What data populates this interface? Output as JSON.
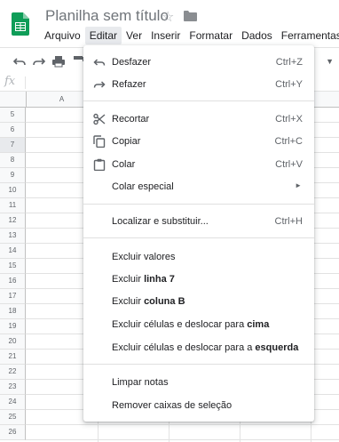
{
  "header": {
    "title": "Planilha sem título",
    "star_icon": "star-outline-icon",
    "folder_icon": "folder-icon",
    "menu": [
      {
        "label": "Arquivo",
        "active": false
      },
      {
        "label": "Editar",
        "active": true
      },
      {
        "label": "Ver",
        "active": false
      },
      {
        "label": "Inserir",
        "active": false
      },
      {
        "label": "Formatar",
        "active": false
      },
      {
        "label": "Dados",
        "active": false
      },
      {
        "label": "Ferramentas",
        "active": false
      }
    ]
  },
  "toolbar": {
    "icons": [
      "undo-icon",
      "redo-icon",
      "print-icon",
      "paint-format-icon"
    ]
  },
  "formula_bar": {
    "fx_label": "fx",
    "value": ""
  },
  "grid": {
    "columns": [
      "",
      "A",
      "",
      "",
      ""
    ],
    "rows": [
      "5",
      "6",
      "7",
      "8",
      "9",
      "10",
      "11",
      "12",
      "13",
      "14",
      "15",
      "16",
      "17",
      "18",
      "19",
      "20",
      "21",
      "22",
      "23",
      "24",
      "25",
      "26"
    ],
    "highlighted_row": "7"
  },
  "edit_menu": {
    "items": [
      {
        "label": "Desfazer",
        "shortcut": "Ctrl+Z",
        "icon": "undo-icon"
      },
      {
        "label": "Refazer",
        "shortcut": "Ctrl+Y",
        "icon": "redo-icon"
      },
      {
        "label": "Recortar",
        "shortcut": "Ctrl+X",
        "icon": "scissors-icon"
      },
      {
        "label": "Copiar",
        "shortcut": "Ctrl+C",
        "icon": "copy-icon"
      },
      {
        "label": "Colar",
        "shortcut": "Ctrl+V",
        "icon": "clipboard-icon"
      },
      {
        "label": "Colar especial",
        "submenu": true
      },
      {
        "label": "Localizar e substituir...",
        "shortcut": "Ctrl+H"
      },
      {
        "label": "Excluir valores"
      },
      {
        "prefix": "Excluir ",
        "bold": "linha 7",
        "suffix": ""
      },
      {
        "prefix": "Excluir ",
        "bold": "coluna B",
        "suffix": ""
      },
      {
        "prefix": "Excluir células e deslocar para ",
        "bold": "cima",
        "suffix": ""
      },
      {
        "prefix": "Excluir células e deslocar para a ",
        "bold": "esquerda",
        "suffix": ""
      },
      {
        "label": "Limpar notas"
      },
      {
        "label": "Remover caixas de seleção"
      }
    ]
  },
  "colors": {
    "accent_green": "#0f9d58",
    "menu_active_bg": "#e8eaed",
    "shortcut_text": "#5f6368"
  }
}
